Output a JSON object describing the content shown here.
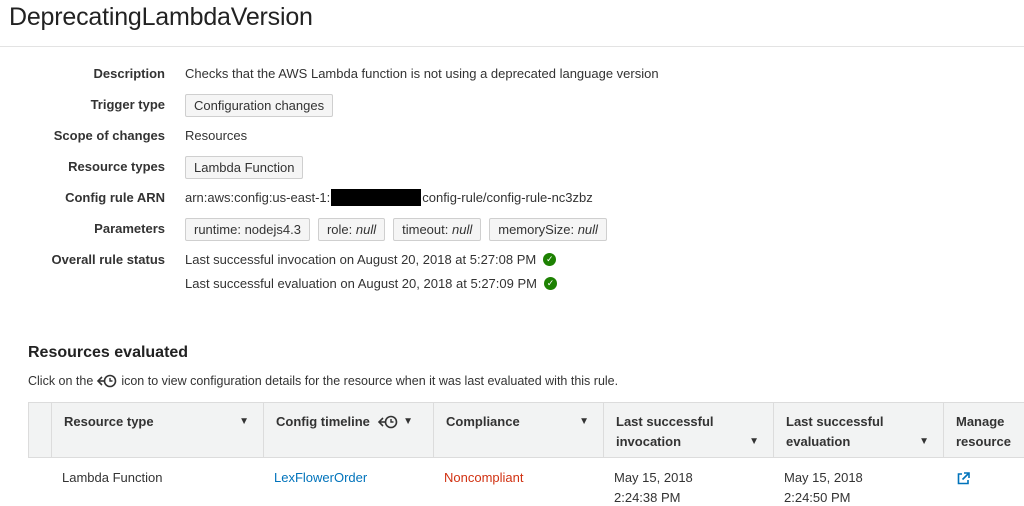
{
  "page": {
    "title": "DeprecatingLambdaVersion"
  },
  "details": {
    "description": {
      "label": "Description",
      "value": "Checks that the AWS Lambda function is not using a deprecated language version"
    },
    "trigger_type": {
      "label": "Trigger type",
      "value": "Configuration changes"
    },
    "scope": {
      "label": "Scope of changes",
      "value": "Resources"
    },
    "resource_types": {
      "label": "Resource types",
      "value": "Lambda Function"
    },
    "arn": {
      "label": "Config rule ARN",
      "prefix": "arn:aws:config:us-east-1:",
      "suffix": "config-rule/config-rule-nc3zbz"
    },
    "parameters": {
      "label": "Parameters",
      "items": [
        {
          "key": "runtime: ",
          "value": "nodejs4.3"
        },
        {
          "key": "role: ",
          "value": "null"
        },
        {
          "key": "timeout: ",
          "value": "null"
        },
        {
          "key": "memorySize: ",
          "value": "null"
        }
      ]
    },
    "status": {
      "label": "Overall rule status",
      "invocation": "Last successful invocation on August 20, 2018 at 5:27:08 PM",
      "evaluation": "Last successful evaluation on August 20, 2018 at 5:27:09 PM"
    }
  },
  "resources": {
    "title": "Resources evaluated",
    "hint_before": "Click on the",
    "hint_after": "icon to view configuration details for the resource when it was last evaluated with this rule.",
    "columns": {
      "resource_type": "Resource type",
      "config_timeline": "Config timeline",
      "compliance": "Compliance",
      "last_invocation_1": "Last successful",
      "last_invocation_2": "invocation",
      "last_evaluation_1": "Last successful",
      "last_evaluation_2": "evaluation",
      "manage_1": "Manage",
      "manage_2": "resource"
    },
    "rows": [
      {
        "resource_type": "Lambda Function",
        "config_timeline": "LexFlowerOrder",
        "compliance": "Noncompliant",
        "invocation_date": "May 15, 2018",
        "invocation_time": "2:24:38 PM",
        "evaluation_date": "May 15, 2018",
        "evaluation_time": "2:24:50 PM"
      }
    ]
  },
  "colors": {
    "link": "#0073bb",
    "noncompliant": "#d13212",
    "success": "#1d8102"
  },
  "icons": {
    "status_ok": "check-circle-icon",
    "timeline": "clock-history-icon",
    "manage": "external-link-icon",
    "sort": "caret-down-icon"
  }
}
